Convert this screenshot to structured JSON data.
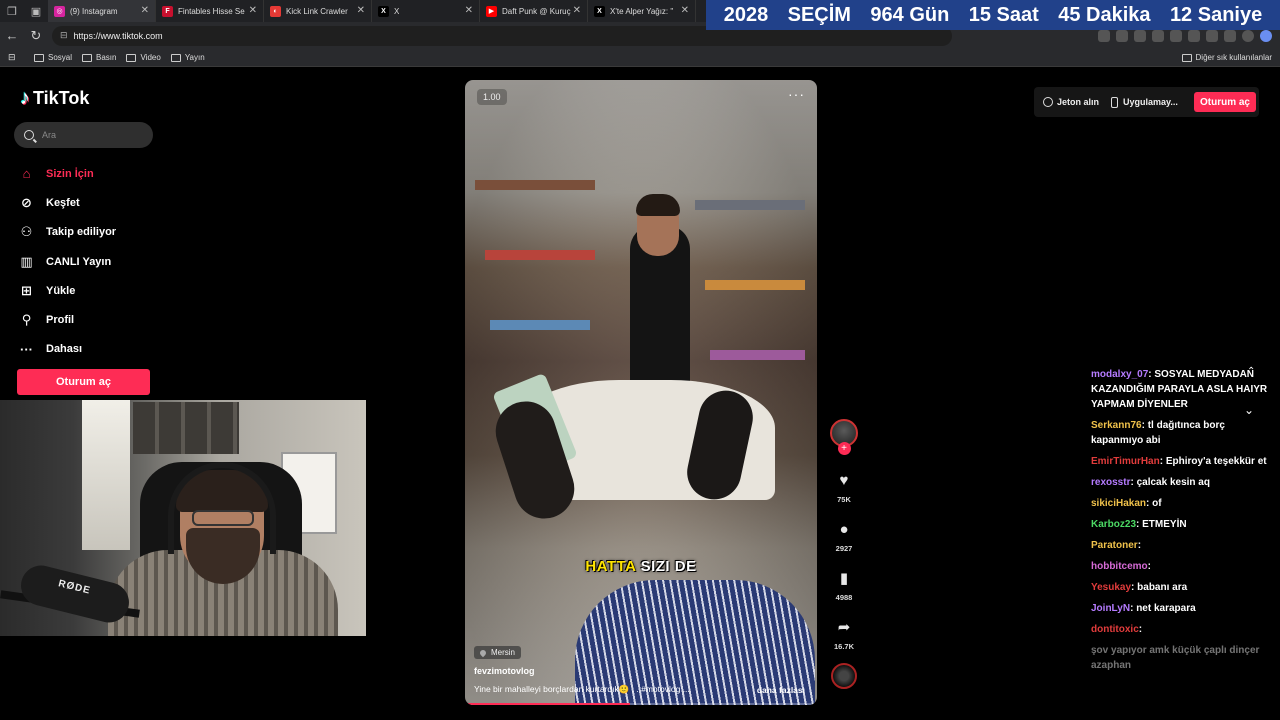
{
  "browser": {
    "tabs": [
      {
        "title": "(9) Instagram",
        "favicon_color": "#d6249f",
        "favicon_glyph": "◎"
      },
      {
        "title": "Fintables Hisse Se",
        "favicon_color": "#c8102e",
        "favicon_glyph": "F"
      },
      {
        "title": "Kick Link Crawler",
        "favicon_color": "#e53935",
        "favicon_glyph": "◐"
      },
      {
        "title": "X",
        "favicon_color": "#000000",
        "favicon_glyph": "𝕏"
      },
      {
        "title": "Daft Punk @ Kuruç",
        "favicon_color": "#ff0000",
        "favicon_glyph": "▶"
      },
      {
        "title": "X'te Alper Yağız: \"",
        "favicon_color": "#000000",
        "favicon_glyph": "𝕏"
      }
    ],
    "url": "https://www.tiktok.com",
    "bookmarks": [
      "Sosyal",
      "Basın",
      "Video",
      "Yayın"
    ],
    "bookmarks_right": "Diğer sık kullanılanlar"
  },
  "countdown": {
    "year": "2028",
    "event": "SEÇİM",
    "days": "964 Gün",
    "hours": "15 Saat",
    "minutes": "45 Dakika",
    "seconds": "12 Saniye"
  },
  "tiktok": {
    "logo_text": "TikTok",
    "search_placeholder": "Ara",
    "nav": [
      {
        "label": "Sizin İçin",
        "icon": "home-icon"
      },
      {
        "label": "Keşfet",
        "icon": "compass-icon"
      },
      {
        "label": "Takip ediliyor",
        "icon": "following-icon"
      },
      {
        "label": "CANLI Yayın",
        "icon": "live-icon"
      },
      {
        "label": "Yükle",
        "icon": "upload-icon"
      },
      {
        "label": "Profil",
        "icon": "profile-icon"
      },
      {
        "label": "Dahası",
        "icon": "more-icon"
      }
    ],
    "login_label": "Oturum aç",
    "header": {
      "coins": "Jeton alın",
      "app": "Uygulamay...",
      "login": "Oturum aç"
    },
    "video": {
      "speed": "1.00",
      "caption_yellow": "HATTA",
      "caption_white": "SIZI DE",
      "location": "Mersin",
      "username": "fevzimotovlog",
      "description": "Yine bir mahalleyi borçlardan kurtardık🙂 . . #motovlog ...",
      "more": "daha fazlası",
      "progress": 0.47
    },
    "actions": {
      "likes": "75K",
      "comments": "2927",
      "saves": "4988",
      "shares": "16.7K"
    }
  },
  "chat": [
    {
      "user": "modalxy_07",
      "color": "#b57bff",
      "text": "SOSYAL MEDYADAN KAZANDIĞIM PARAYLA ASLA HAIYR YAPMAM DİYENLER"
    },
    {
      "user": "Serkann76",
      "color": "#f0c24b",
      "text": "tl dağıtınca borç kapanmıyo abi"
    },
    {
      "user": "EmirTimurHan",
      "color": "#e23c3c",
      "text": "Ephiroy'a teşekkür et"
    },
    {
      "user": "rexosstr",
      "color": "#b57bff",
      "text": "çalcak kesin aq"
    },
    {
      "user": "sikiciHakan",
      "color": "#f0c24b",
      "text": "of"
    },
    {
      "user": "Karboz23",
      "color": "#4cd964",
      "text": "ETMEYİN"
    },
    {
      "user": "Paratoner",
      "color": "#f0c24b",
      "text": ""
    },
    {
      "user": "hobbitcemo",
      "color": "#d66bd6",
      "text": ""
    },
    {
      "user": "Yesukay",
      "color": "#e23c3c",
      "text": "babanı ara"
    },
    {
      "user": "JoinLyN",
      "color": "#b57bff",
      "text": "net karapara"
    },
    {
      "user": "dontitoxic",
      "color": "#e23c3c",
      "text": ""
    },
    {
      "user": "",
      "color": "#e23c3c",
      "text": "şov yapıyor amk küçük çaplı dinçer azaphan"
    }
  ]
}
